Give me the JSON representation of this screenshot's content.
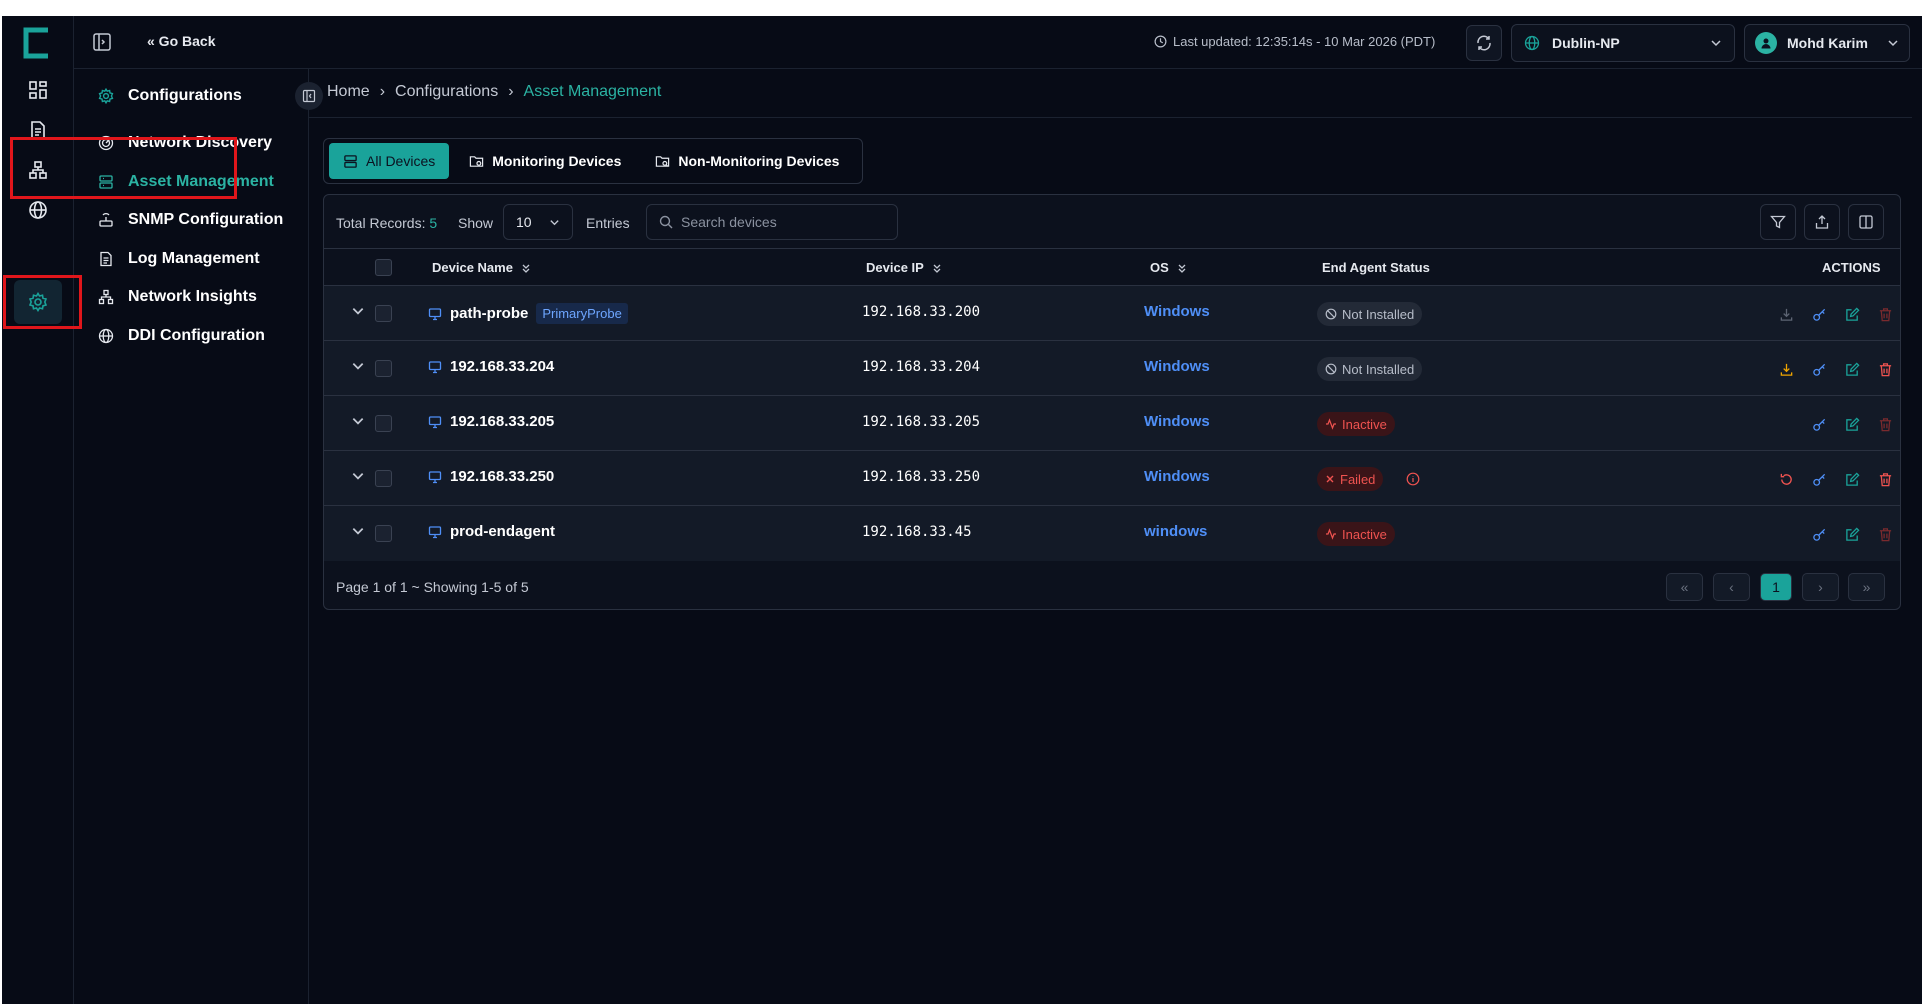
{
  "topbar": {
    "go_back": "« Go Back",
    "last_updated": "Last updated: 12:35:14s - 10 Mar 2026 (PDT)",
    "site": "Dublin-NP",
    "user": "Mohd Karim"
  },
  "sidebar": {
    "title": "Configurations",
    "items": [
      {
        "label": "Network Discovery",
        "icon": "radar-icon"
      },
      {
        "label": "Asset Management",
        "icon": "server-icon"
      },
      {
        "label": "SNMP Configuration",
        "icon": "router-icon"
      },
      {
        "label": "Log Management",
        "icon": "document-icon"
      },
      {
        "label": "Network Insights",
        "icon": "network-icon"
      },
      {
        "label": "DDI Configuration",
        "icon": "globe-icon"
      }
    ]
  },
  "breadcrumb": {
    "home": "Home",
    "section": "Configurations",
    "current": "Asset Management",
    "sep": "›"
  },
  "tabs": [
    "All Devices",
    "Monitoring Devices",
    "Non-Monitoring Devices"
  ],
  "toolbar": {
    "total_label": "Total Records:",
    "total_value": "5",
    "show_label": "Show",
    "show_value": "10",
    "entries_label": "Entries",
    "search_placeholder": "Search devices"
  },
  "table": {
    "headers": {
      "device_name": "Device Name",
      "device_ip": "Device IP",
      "os": "OS",
      "status": "End Agent Status",
      "actions": "ACTIONS"
    },
    "rows": [
      {
        "name": "path-probe",
        "badge": "PrimaryProbe",
        "ip": "192.168.33.200",
        "os": "Windows",
        "status": "Not Installed"
      },
      {
        "name": "192.168.33.204",
        "badge": "",
        "ip": "192.168.33.204",
        "os": "Windows",
        "status": "Not Installed"
      },
      {
        "name": "192.168.33.205",
        "badge": "",
        "ip": "192.168.33.205",
        "os": "Windows",
        "status": "Inactive"
      },
      {
        "name": "192.168.33.250",
        "badge": "",
        "ip": "192.168.33.250",
        "os": "Windows",
        "status": "Failed"
      },
      {
        "name": "prod-endagent",
        "badge": "",
        "ip": "192.168.33.45",
        "os": "windows",
        "status": "Inactive"
      }
    ]
  },
  "pagination": {
    "summary": "Page 1 of 1 ~ Showing 1-5 of 5",
    "current_page": "1",
    "first": "«",
    "prev": "‹",
    "next": "›",
    "last": "»"
  },
  "colors": {
    "accent": "#1aa39a",
    "link": "#4f8ff7",
    "danger": "#ef5350",
    "warning": "#f0a500",
    "highlight": "#e0161b"
  }
}
